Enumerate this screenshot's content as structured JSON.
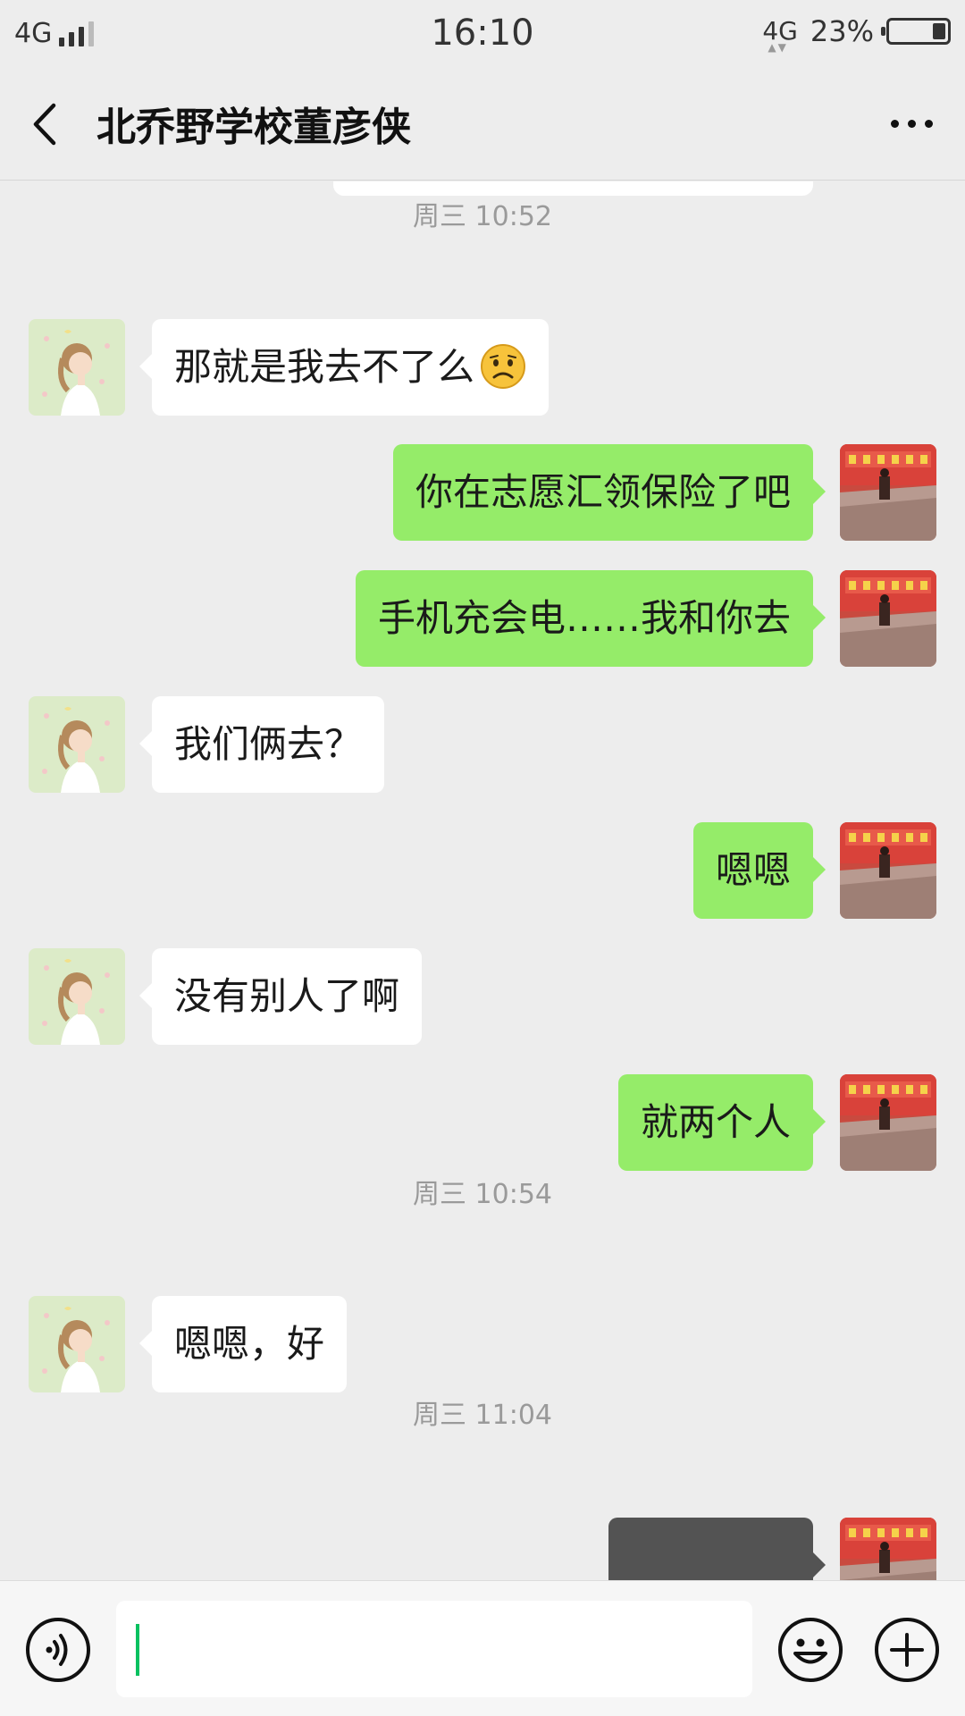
{
  "status_bar": {
    "network_left": "4G",
    "time": "16:10",
    "network_right": "4G",
    "battery_percent_label": "23%",
    "battery_level": 0.23
  },
  "header": {
    "title": "北乔野学校董彦侠"
  },
  "timestamps": [
    "周三 10:52",
    "周三 10:54",
    "周三 11:04"
  ],
  "messages": [
    {
      "side": "left",
      "text": "那就是我去不了么",
      "emoji": "frowning-face"
    },
    {
      "side": "right",
      "text": "你在志愿汇领保险了吧"
    },
    {
      "side": "right",
      "text": "手机充会电……我和你去"
    },
    {
      "side": "left",
      "text": "我们俩去？"
    },
    {
      "side": "right",
      "text": "嗯嗯"
    },
    {
      "side": "left",
      "text": "没有别人了啊"
    },
    {
      "side": "right",
      "text": "就两个人"
    },
    {
      "side": "left",
      "text": "嗯嗯，好"
    },
    {
      "side": "right",
      "text": ""
    }
  ],
  "input_bar": {
    "placeholder": "",
    "icons": [
      "voice-icon",
      "emoji-icon",
      "plus-icon"
    ]
  },
  "colors": {
    "background": "#ededed",
    "sent_bubble": "#95ec69",
    "received_bubble": "#ffffff",
    "caret": "#07c160"
  }
}
